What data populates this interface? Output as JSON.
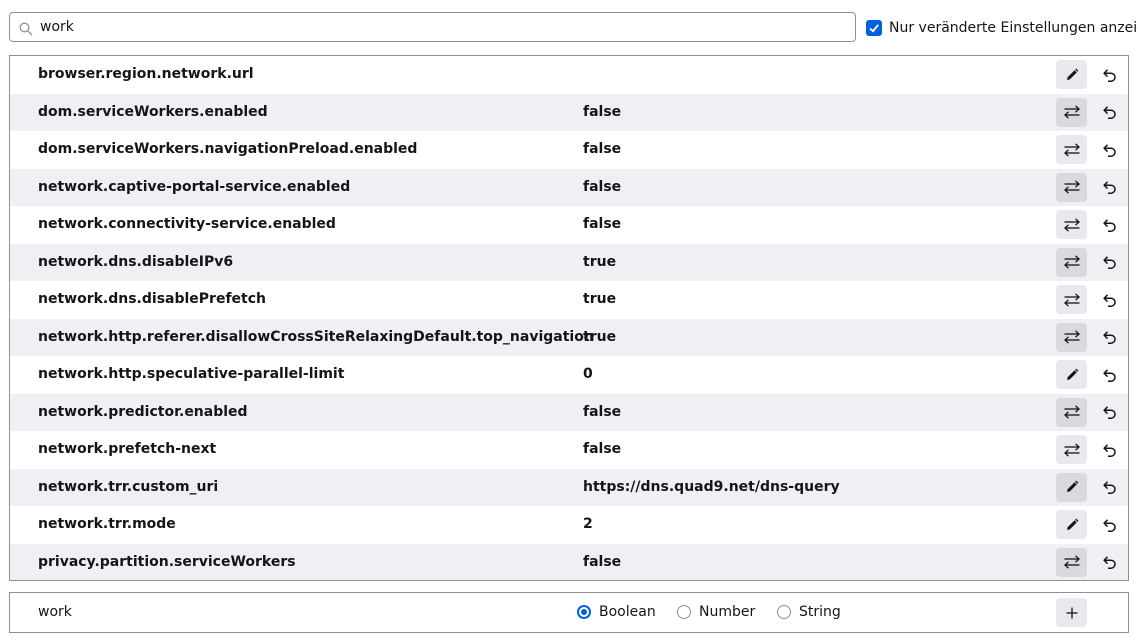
{
  "search": {
    "value": "work",
    "icon": "search-icon"
  },
  "filter": {
    "checked": true,
    "label": "Nur veränderte Einstellungen anzeigen"
  },
  "prefs": [
    {
      "name": "browser.region.network.url",
      "value": "",
      "action": "edit"
    },
    {
      "name": "dom.serviceWorkers.enabled",
      "value": "false",
      "action": "toggle"
    },
    {
      "name": "dom.serviceWorkers.navigationPreload.enabled",
      "value": "false",
      "action": "toggle"
    },
    {
      "name": "network.captive-portal-service.enabled",
      "value": "false",
      "action": "toggle"
    },
    {
      "name": "network.connectivity-service.enabled",
      "value": "false",
      "action": "toggle"
    },
    {
      "name": "network.dns.disableIPv6",
      "value": "true",
      "action": "toggle"
    },
    {
      "name": "network.dns.disablePrefetch",
      "value": "true",
      "action": "toggle"
    },
    {
      "name": "network.http.referer.disallowCrossSiteRelaxingDefault.top_navigation",
      "value": "true",
      "action": "toggle"
    },
    {
      "name": "network.http.speculative-parallel-limit",
      "value": "0",
      "action": "edit"
    },
    {
      "name": "network.predictor.enabled",
      "value": "false",
      "action": "toggle"
    },
    {
      "name": "network.prefetch-next",
      "value": "false",
      "action": "toggle"
    },
    {
      "name": "network.trr.custom_uri",
      "value": "https://dns.quad9.net/dns-query",
      "action": "edit"
    },
    {
      "name": "network.trr.mode",
      "value": "2",
      "action": "edit"
    },
    {
      "name": "privacy.partition.serviceWorkers",
      "value": "false",
      "action": "toggle"
    }
  ],
  "add_row": {
    "name": "work",
    "types": [
      {
        "label": "Boolean",
        "checked": true
      },
      {
        "label": "Number",
        "checked": false
      },
      {
        "label": "String",
        "checked": false
      }
    ]
  },
  "colors": {
    "accent": "#0060df",
    "row_alt": "#f0f0f4",
    "border": "#8f8f9d"
  }
}
